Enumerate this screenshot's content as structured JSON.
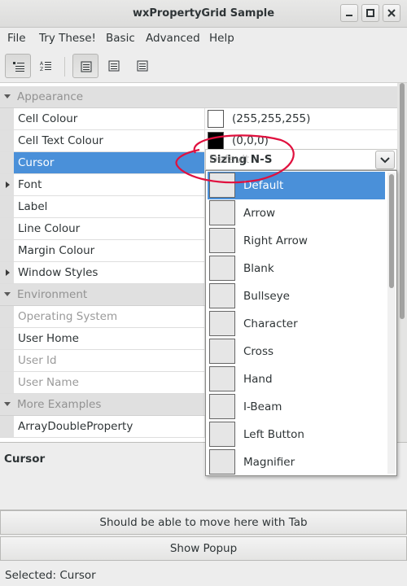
{
  "window": {
    "title": "wxPropertyGrid Sample"
  },
  "menu": [
    "File",
    "Try These!",
    "Basic",
    "Advanced",
    "Help"
  ],
  "toolbar": {
    "buttons": [
      "categorized-view-icon",
      "alphabetic-view-icon",
      "page-1-icon",
      "page-2-icon",
      "page-3-icon"
    ]
  },
  "grid": {
    "rows": [
      {
        "kind": "category",
        "label": "Appearance",
        "expanded": true
      },
      {
        "kind": "property",
        "label": "Cell Colour",
        "value": "(255,255,255)",
        "swatch": "#ffffff"
      },
      {
        "kind": "property",
        "label": "Cell Text Colour",
        "value": "(0,0,0)",
        "swatch": "#000000"
      },
      {
        "kind": "property",
        "label": "Cursor",
        "selected": true
      },
      {
        "kind": "property",
        "label": "Font",
        "expandable": true
      },
      {
        "kind": "property",
        "label": "Label"
      },
      {
        "kind": "property",
        "label": "Line Colour"
      },
      {
        "kind": "property",
        "label": "Margin Colour"
      },
      {
        "kind": "property",
        "label": "Window Styles",
        "expandable": true
      },
      {
        "kind": "category",
        "label": "Environment",
        "expanded": true
      },
      {
        "kind": "property",
        "label": "Operating System",
        "disabled": true
      },
      {
        "kind": "property",
        "label": "User Home"
      },
      {
        "kind": "property",
        "label": "User Id",
        "disabled": true
      },
      {
        "kind": "property",
        "label": "User Name",
        "disabled": true
      },
      {
        "kind": "category",
        "label": "More Examples",
        "expanded": true
      },
      {
        "kind": "property",
        "label": "ArrayDoubleProperty"
      }
    ]
  },
  "editor": {
    "text": "Sizing N-S",
    "overlap_text": "Default"
  },
  "popup": {
    "items": [
      "Default",
      "Arrow",
      "Right Arrow",
      "Blank",
      "Bullseye",
      "Character",
      "Cross",
      "Hand",
      "I-Beam",
      "Left Button",
      "Magnifier"
    ],
    "selected": "Default"
  },
  "description": {
    "title": "Cursor"
  },
  "buttons": {
    "tab_button": "Should be able to move here with Tab",
    "popup_button": "Show Popup"
  },
  "status": {
    "text": "Selected: Cursor"
  },
  "colors": {
    "selection": "#4a90d9",
    "annotation": "#e0103e"
  }
}
